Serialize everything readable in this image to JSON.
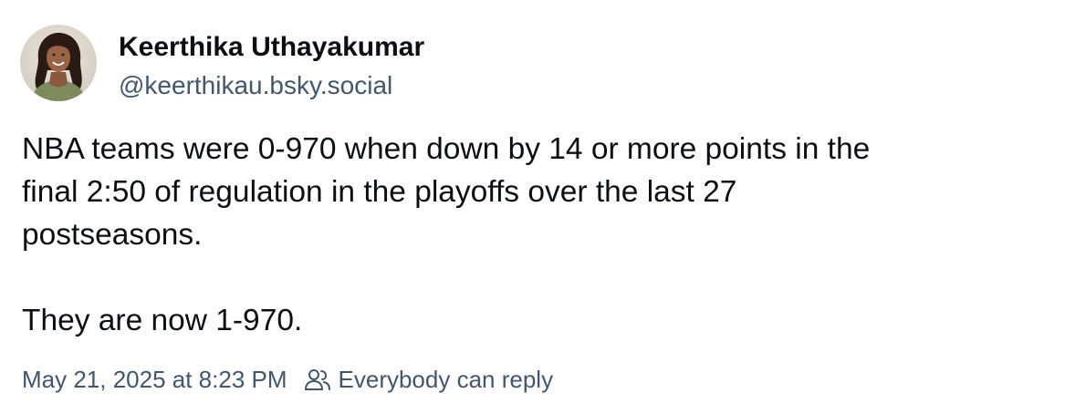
{
  "author": {
    "display_name": "Keerthika Uthayakumar",
    "handle": "@keerthikau.bsky.social",
    "avatar_icon": "profile-photo"
  },
  "post": {
    "lines": [
      "NBA teams were 0-970 when down by 14 or more points in the",
      "final 2:50 of regulation in the playoffs over the last 27",
      "postseasons."
    ],
    "second_paragraph": "They are now 1-970."
  },
  "meta": {
    "timestamp": "May 21, 2025 at 8:23 PM",
    "reply_icon": "people-icon",
    "reply_setting": "Everybody can reply"
  },
  "colors": {
    "text_primary": "#0b0f14",
    "text_secondary": "#42576c",
    "background": "#ffffff"
  }
}
